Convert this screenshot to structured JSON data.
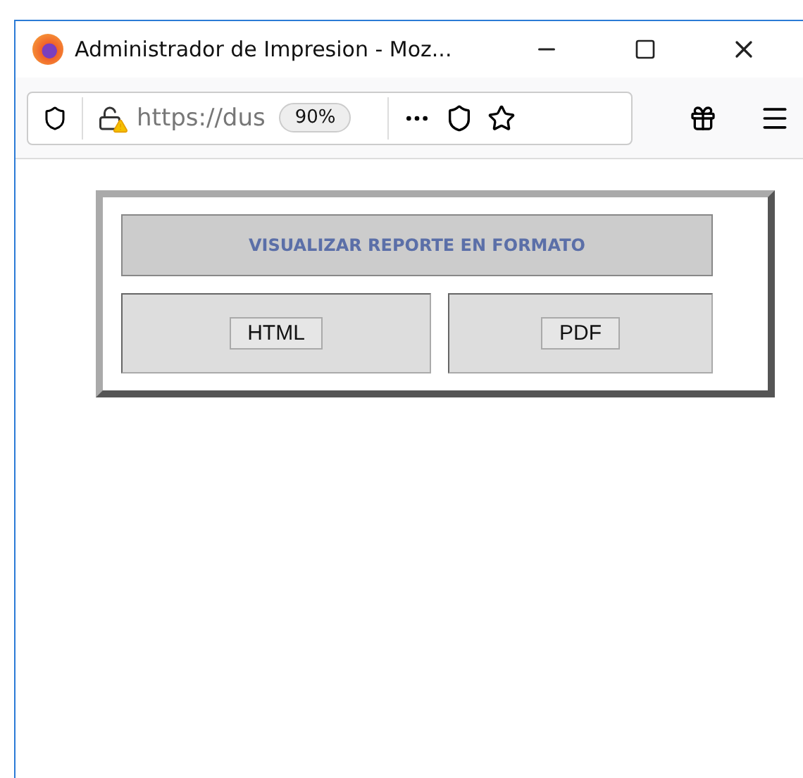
{
  "window": {
    "title": "Administrador de Impresion - Moz..."
  },
  "toolbar": {
    "url": "https://dus",
    "zoom": "90%"
  },
  "report": {
    "heading": "VISUALIZAR REPORTE EN FORMATO",
    "buttons": [
      {
        "label": "HTML"
      },
      {
        "label": "PDF"
      }
    ]
  }
}
